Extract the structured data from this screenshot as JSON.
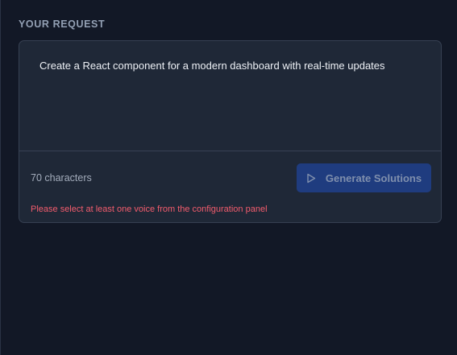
{
  "section": {
    "title": "YOUR REQUEST"
  },
  "request": {
    "text": "Create a React component for a modern dashboard with real-time updates",
    "char_count": "70 characters"
  },
  "actions": {
    "generate_label": "Generate Solutions",
    "generate_icon": "play-icon"
  },
  "validation": {
    "error": "Please select at least one voice from the configuration panel"
  },
  "colors": {
    "background": "#121826",
    "card": "#1f2837",
    "button_disabled": "#1f3c7f",
    "error": "#f25c6d"
  }
}
